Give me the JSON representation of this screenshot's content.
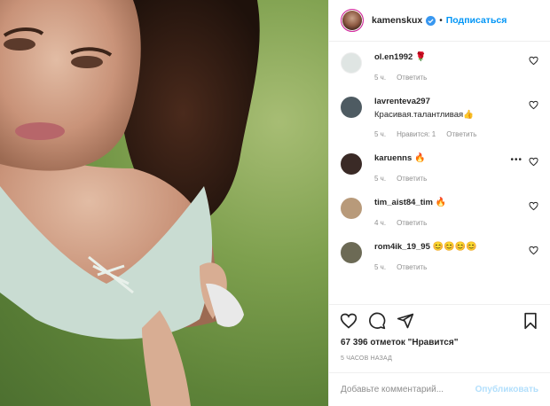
{
  "post": {
    "username": "kamenskux",
    "follow_label": "Подписаться",
    "dot": "•",
    "more": "•••",
    "likes": "67 396 отметок \"Нравится\"",
    "time": "5 ЧАСОВ НАЗАД",
    "comment_placeholder": "Добавьте комментарий...",
    "publish_label": "Опубликовать"
  },
  "comments": [
    {
      "user": "ol.en1992",
      "emoji": "🌹",
      "text": "",
      "time": "5 ч.",
      "likes": "",
      "reply": "Ответить",
      "avatar_color": "#dfe5e3"
    },
    {
      "user": "lavrenteva297",
      "emoji": "",
      "text": "Красивая.талантливая👍",
      "time": "5 ч.",
      "likes": "Нравится: 1",
      "reply": "Ответить",
      "avatar_color": "#4e5b62"
    },
    {
      "user": "karuenns",
      "emoji": "🔥",
      "text": "",
      "time": "5 ч.",
      "likes": "",
      "reply": "Ответить",
      "avatar_color": "#3a2a26",
      "show_more": true
    },
    {
      "user": "tim_aist84_tim",
      "emoji": "🔥",
      "text": "",
      "time": "4 ч.",
      "likes": "",
      "reply": "Ответить",
      "avatar_color": "#b89a7a"
    },
    {
      "user": "rom4ik_19_95",
      "emoji": "😊😊😊😊",
      "text": "",
      "time": "5 ч.",
      "likes": "",
      "reply": "Ответить",
      "avatar_color": "#6c6a55"
    }
  ],
  "colors": {
    "link": "#0095f6",
    "publish_disabled": "#b2dffc",
    "muted": "#8e8e8e"
  },
  "icons": [
    "heart-icon",
    "comment-icon",
    "share-icon",
    "bookmark-icon",
    "verified-badge-icon"
  ]
}
